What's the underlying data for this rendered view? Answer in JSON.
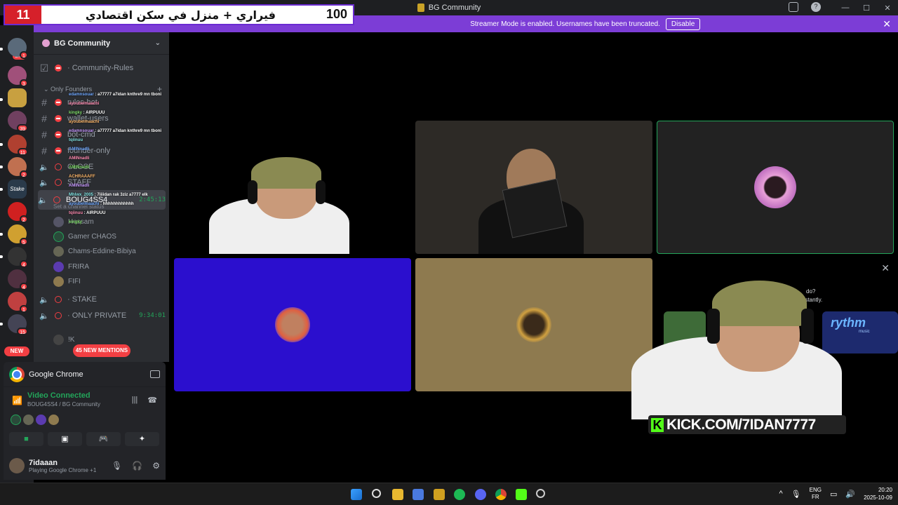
{
  "window": {
    "title": "BG Community",
    "controls": [
      "—",
      "☐",
      "✕"
    ]
  },
  "overlay": {
    "left_number": "11",
    "arabic_text": "فيراري + منزل في سكن اقتصادي",
    "right_number": "100"
  },
  "streamer_bar": {
    "message": "Streamer Mode is enabled. Usernames have been truncated.",
    "disable_label": "Disable"
  },
  "server_rail": {
    "top_badge": "1K+",
    "new_label": "NEW",
    "badges": [
      "1",
      "3",
      "39",
      "11",
      "2",
      "2",
      "5",
      "4",
      "4",
      "1",
      "15"
    ]
  },
  "server": {
    "name": "BG Community"
  },
  "channels": {
    "rules": "Community-Rules",
    "category": "Only Founders",
    "text_channels": [
      "rules-bot",
      "wallet-users",
      "bot-cmd",
      "founder-only"
    ],
    "voice_channels": [
      "CLOSE",
      "STAFF"
    ],
    "active_channel": "BOUG4SS4",
    "active_timer": "2:45:13",
    "set_status": "Set a channel status",
    "members": [
      "Hossam",
      "Gamer CHAOS",
      "Chams-Eddine-Bibiya",
      "FRIRA",
      "FIFI"
    ],
    "stake": "STAKE",
    "only_private": "ONLY PRIVATE",
    "only_private_timer": "9:34:01",
    "bottom_partial": "!K"
  },
  "chat_overlay": [
    {
      "user": "edamnsouar",
      "msg": "a77777 a7idan knthre9 mn tboni"
    },
    {
      "user": "ayoubelmaachi",
      "msg": ""
    },
    {
      "user": "kingky",
      "msg": "AIRPUUU"
    },
    {
      "user": "ayoubelmaachi",
      "msg": ""
    },
    {
      "user": "edamnsouar",
      "msg": "a77777 a7idan knthre9 mn tboni"
    },
    {
      "user": "tqiinuu",
      "msg": ""
    },
    {
      "user": "AMINnadli",
      "msg": ""
    },
    {
      "user": "AMINnadli",
      "msg": ""
    },
    {
      "user": "AMINnadli",
      "msg": ""
    },
    {
      "user": "ACHRAAAFF",
      "msg": ""
    },
    {
      "user": "AMINnadli",
      "msg": ""
    },
    {
      "user": "Mhlwx_2005",
      "msg": "7iiiidan rak 3ziz a7777 elk"
    },
    {
      "user": "ayoubelmaachi",
      "msg": "hhhhhhhhhhhh"
    },
    {
      "user": "tqiinuu",
      "msg": "AIRPUUU"
    },
    {
      "user": "kingky",
      "msg": ""
    }
  ],
  "mentions_label": "45 NEW MENTIONS",
  "activity": {
    "app": "Google Chrome",
    "vc_status": "Video Connected",
    "vc_location": "BOUG4SS4 / BG Community"
  },
  "user": {
    "name": "7idaaan",
    "status": "Playing Google Chrome +1"
  },
  "promo": {
    "line1": "do?",
    "line2": "nstantly.",
    "brand": "rythm",
    "brand_sub": "music"
  },
  "kick_url": "KICK.COM/7IDAN7777",
  "taskbar": {
    "lang_top": "ENG",
    "lang_bottom": "FR",
    "time": "20:20",
    "date": "2025-10-09"
  },
  "colors": {
    "streamer_purple": "#7c3dd6",
    "discord_green": "#23a55a",
    "discord_red": "#f23f43",
    "kick_green": "#53fc18",
    "tile_blue": "#2b0fce",
    "tile_tan": "#8e7a4f"
  }
}
